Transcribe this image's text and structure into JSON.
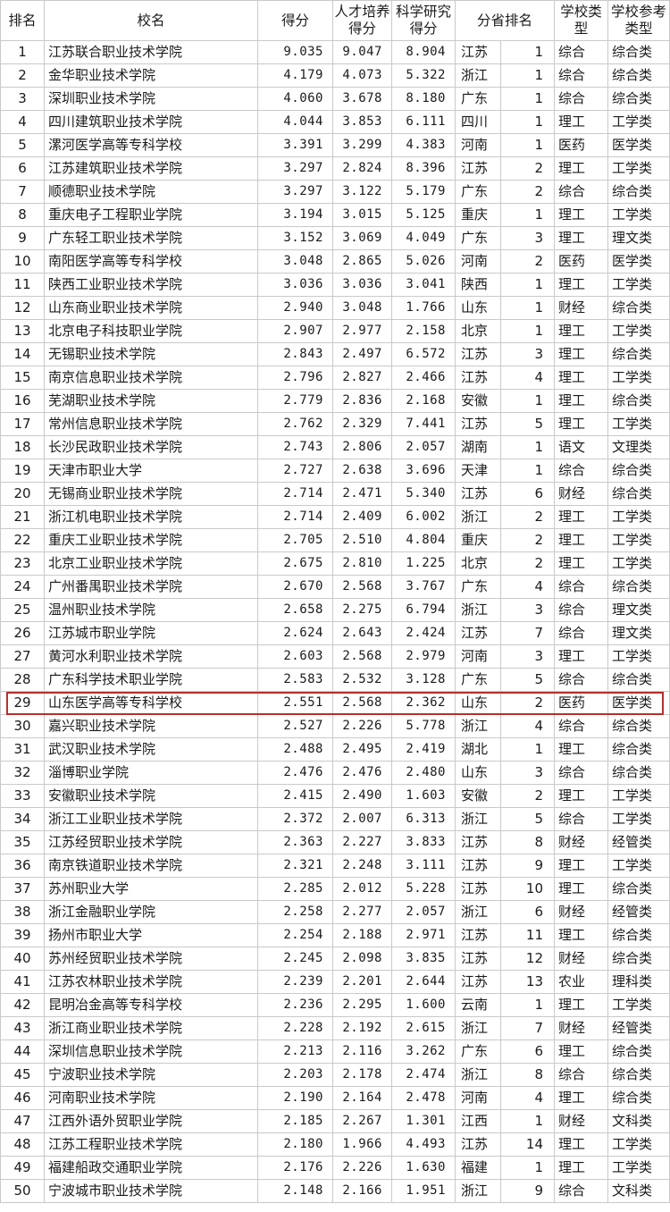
{
  "headers": {
    "rank": "排名",
    "name": "校名",
    "score": "得分",
    "talent": "人才培养得分",
    "research": "科学研究得分",
    "prov_rank": "分省排名",
    "school_type": "学校类型",
    "ref_type": "学校参考类型"
  },
  "highlight_rank": 29,
  "rows": [
    {
      "rank": "1",
      "name": "江苏联合职业技术学院",
      "score": "9.035",
      "talent": "9.047",
      "research": "8.904",
      "province": "江苏",
      "prov_rank": "1",
      "type": "综合",
      "ref": "综合类"
    },
    {
      "rank": "2",
      "name": "金华职业技术学院",
      "score": "4.179",
      "talent": "4.073",
      "research": "5.322",
      "province": "浙江",
      "prov_rank": "1",
      "type": "综合",
      "ref": "综合类"
    },
    {
      "rank": "3",
      "name": "深圳职业技术学院",
      "score": "4.060",
      "talent": "3.678",
      "research": "8.180",
      "province": "广东",
      "prov_rank": "1",
      "type": "综合",
      "ref": "综合类"
    },
    {
      "rank": "4",
      "name": "四川建筑职业技术学院",
      "score": "4.044",
      "talent": "3.853",
      "research": "6.111",
      "province": "四川",
      "prov_rank": "1",
      "type": "理工",
      "ref": "工学类"
    },
    {
      "rank": "5",
      "name": "漯河医学高等专科学校",
      "score": "3.391",
      "talent": "3.299",
      "research": "4.383",
      "province": "河南",
      "prov_rank": "1",
      "type": "医药",
      "ref": "医学类"
    },
    {
      "rank": "6",
      "name": "江苏建筑职业技术学院",
      "score": "3.297",
      "talent": "2.824",
      "research": "8.396",
      "province": "江苏",
      "prov_rank": "2",
      "type": "理工",
      "ref": "工学类"
    },
    {
      "rank": "7",
      "name": "顺德职业技术学院",
      "score": "3.297",
      "talent": "3.122",
      "research": "5.179",
      "province": "广东",
      "prov_rank": "2",
      "type": "综合",
      "ref": "综合类"
    },
    {
      "rank": "8",
      "name": "重庆电子工程职业学院",
      "score": "3.194",
      "talent": "3.015",
      "research": "5.125",
      "province": "重庆",
      "prov_rank": "1",
      "type": "理工",
      "ref": "工学类"
    },
    {
      "rank": "9",
      "name": "广东轻工职业技术学院",
      "score": "3.152",
      "talent": "3.069",
      "research": "4.049",
      "province": "广东",
      "prov_rank": "3",
      "type": "理工",
      "ref": "理文类"
    },
    {
      "rank": "10",
      "name": "南阳医学高等专科学校",
      "score": "3.048",
      "talent": "2.865",
      "research": "5.026",
      "province": "河南",
      "prov_rank": "2",
      "type": "医药",
      "ref": "医学类"
    },
    {
      "rank": "11",
      "name": "陕西工业职业技术学院",
      "score": "3.036",
      "talent": "3.036",
      "research": "3.041",
      "province": "陕西",
      "prov_rank": "1",
      "type": "理工",
      "ref": "工学类"
    },
    {
      "rank": "12",
      "name": "山东商业职业技术学院",
      "score": "2.940",
      "talent": "3.048",
      "research": "1.766",
      "province": "山东",
      "prov_rank": "1",
      "type": "财经",
      "ref": "综合类"
    },
    {
      "rank": "13",
      "name": "北京电子科技职业学院",
      "score": "2.907",
      "talent": "2.977",
      "research": "2.158",
      "province": "北京",
      "prov_rank": "1",
      "type": "理工",
      "ref": "工学类"
    },
    {
      "rank": "14",
      "name": "无锡职业技术学院",
      "score": "2.843",
      "talent": "2.497",
      "research": "6.572",
      "province": "江苏",
      "prov_rank": "3",
      "type": "理工",
      "ref": "综合类"
    },
    {
      "rank": "15",
      "name": "南京信息职业技术学院",
      "score": "2.796",
      "talent": "2.827",
      "research": "2.466",
      "province": "江苏",
      "prov_rank": "4",
      "type": "理工",
      "ref": "工学类"
    },
    {
      "rank": "16",
      "name": "芜湖职业技术学院",
      "score": "2.779",
      "talent": "2.836",
      "research": "2.168",
      "province": "安徽",
      "prov_rank": "1",
      "type": "理工",
      "ref": "综合类"
    },
    {
      "rank": "17",
      "name": "常州信息职业技术学院",
      "score": "2.762",
      "talent": "2.329",
      "research": "7.441",
      "province": "江苏",
      "prov_rank": "5",
      "type": "理工",
      "ref": "工学类"
    },
    {
      "rank": "18",
      "name": "长沙民政职业技术学院",
      "score": "2.743",
      "talent": "2.806",
      "research": "2.057",
      "province": "湖南",
      "prov_rank": "1",
      "type": "语文",
      "ref": "文理类"
    },
    {
      "rank": "19",
      "name": "天津市职业大学",
      "score": "2.727",
      "talent": "2.638",
      "research": "3.696",
      "province": "天津",
      "prov_rank": "1",
      "type": "综合",
      "ref": "综合类"
    },
    {
      "rank": "20",
      "name": "无锡商业职业技术学院",
      "score": "2.714",
      "talent": "2.471",
      "research": "5.340",
      "province": "江苏",
      "prov_rank": "6",
      "type": "财经",
      "ref": "综合类"
    },
    {
      "rank": "21",
      "name": "浙江机电职业技术学院",
      "score": "2.714",
      "talent": "2.409",
      "research": "6.002",
      "province": "浙江",
      "prov_rank": "2",
      "type": "理工",
      "ref": "工学类"
    },
    {
      "rank": "22",
      "name": "重庆工业职业技术学院",
      "score": "2.705",
      "talent": "2.510",
      "research": "4.804",
      "province": "重庆",
      "prov_rank": "2",
      "type": "理工",
      "ref": "工学类"
    },
    {
      "rank": "23",
      "name": "北京工业职业技术学院",
      "score": "2.675",
      "talent": "2.810",
      "research": "1.225",
      "province": "北京",
      "prov_rank": "2",
      "type": "理工",
      "ref": "工学类"
    },
    {
      "rank": "24",
      "name": "广州番禺职业技术学院",
      "score": "2.670",
      "talent": "2.568",
      "research": "3.767",
      "province": "广东",
      "prov_rank": "4",
      "type": "综合",
      "ref": "综合类"
    },
    {
      "rank": "25",
      "name": "温州职业技术学院",
      "score": "2.658",
      "talent": "2.275",
      "research": "6.794",
      "province": "浙江",
      "prov_rank": "3",
      "type": "综合",
      "ref": "理文类"
    },
    {
      "rank": "26",
      "name": "江苏城市职业学院",
      "score": "2.624",
      "talent": "2.643",
      "research": "2.424",
      "province": "江苏",
      "prov_rank": "7",
      "type": "综合",
      "ref": "理文类"
    },
    {
      "rank": "27",
      "name": "黄河水利职业技术学院",
      "score": "2.603",
      "talent": "2.568",
      "research": "2.979",
      "province": "河南",
      "prov_rank": "3",
      "type": "理工",
      "ref": "工学类"
    },
    {
      "rank": "28",
      "name": "广东科学技术职业学院",
      "score": "2.583",
      "talent": "2.532",
      "research": "3.128",
      "province": "广东",
      "prov_rank": "5",
      "type": "综合",
      "ref": "综合类"
    },
    {
      "rank": "29",
      "name": "山东医学高等专科学校",
      "score": "2.551",
      "talent": "2.568",
      "research": "2.362",
      "province": "山东",
      "prov_rank": "2",
      "type": "医药",
      "ref": "医学类"
    },
    {
      "rank": "30",
      "name": "嘉兴职业技术学院",
      "score": "2.527",
      "talent": "2.226",
      "research": "5.778",
      "province": "浙江",
      "prov_rank": "4",
      "type": "综合",
      "ref": "综合类"
    },
    {
      "rank": "31",
      "name": "武汉职业技术学院",
      "score": "2.488",
      "talent": "2.495",
      "research": "2.419",
      "province": "湖北",
      "prov_rank": "1",
      "type": "理工",
      "ref": "综合类"
    },
    {
      "rank": "32",
      "name": "淄博职业学院",
      "score": "2.476",
      "talent": "2.476",
      "research": "2.480",
      "province": "山东",
      "prov_rank": "3",
      "type": "综合",
      "ref": "综合类"
    },
    {
      "rank": "33",
      "name": "安徽职业技术学院",
      "score": "2.415",
      "talent": "2.490",
      "research": "1.603",
      "province": "安徽",
      "prov_rank": "2",
      "type": "理工",
      "ref": "工学类"
    },
    {
      "rank": "34",
      "name": "浙江工业职业技术学院",
      "score": "2.372",
      "talent": "2.007",
      "research": "6.313",
      "province": "浙江",
      "prov_rank": "5",
      "type": "综合",
      "ref": "工学类"
    },
    {
      "rank": "35",
      "name": "江苏经贸职业技术学院",
      "score": "2.363",
      "talent": "2.227",
      "research": "3.833",
      "province": "江苏",
      "prov_rank": "8",
      "type": "财经",
      "ref": "经管类"
    },
    {
      "rank": "36",
      "name": "南京铁道职业技术学院",
      "score": "2.321",
      "talent": "2.248",
      "research": "3.111",
      "province": "江苏",
      "prov_rank": "9",
      "type": "理工",
      "ref": "工学类"
    },
    {
      "rank": "37",
      "name": "苏州职业大学",
      "score": "2.285",
      "talent": "2.012",
      "research": "5.228",
      "province": "江苏",
      "prov_rank": "10",
      "type": "理工",
      "ref": "综合类"
    },
    {
      "rank": "38",
      "name": "浙江金融职业学院",
      "score": "2.258",
      "talent": "2.277",
      "research": "2.057",
      "province": "浙江",
      "prov_rank": "6",
      "type": "财经",
      "ref": "经管类"
    },
    {
      "rank": "39",
      "name": "扬州市职业大学",
      "score": "2.254",
      "talent": "2.188",
      "research": "2.971",
      "province": "江苏",
      "prov_rank": "11",
      "type": "理工",
      "ref": "综合类"
    },
    {
      "rank": "40",
      "name": "苏州经贸职业技术学院",
      "score": "2.245",
      "talent": "2.098",
      "research": "3.835",
      "province": "江苏",
      "prov_rank": "12",
      "type": "财经",
      "ref": "综合类"
    },
    {
      "rank": "41",
      "name": "江苏农林职业技术学院",
      "score": "2.239",
      "talent": "2.201",
      "research": "2.644",
      "province": "江苏",
      "prov_rank": "13",
      "type": "农业",
      "ref": "理科类"
    },
    {
      "rank": "42",
      "name": "昆明冶金高等专科学校",
      "score": "2.236",
      "talent": "2.295",
      "research": "1.600",
      "province": "云南",
      "prov_rank": "1",
      "type": "理工",
      "ref": "工学类"
    },
    {
      "rank": "43",
      "name": "浙江商业职业技术学院",
      "score": "2.228",
      "talent": "2.192",
      "research": "2.615",
      "province": "浙江",
      "prov_rank": "7",
      "type": "财经",
      "ref": "经管类"
    },
    {
      "rank": "44",
      "name": "深圳信息职业技术学院",
      "score": "2.213",
      "talent": "2.116",
      "research": "3.262",
      "province": "广东",
      "prov_rank": "6",
      "type": "理工",
      "ref": "综合类"
    },
    {
      "rank": "45",
      "name": "宁波职业技术学院",
      "score": "2.203",
      "talent": "2.178",
      "research": "2.474",
      "province": "浙江",
      "prov_rank": "8",
      "type": "综合",
      "ref": "综合类"
    },
    {
      "rank": "46",
      "name": "河南职业技术学院",
      "score": "2.190",
      "talent": "2.164",
      "research": "2.478",
      "province": "河南",
      "prov_rank": "4",
      "type": "理工",
      "ref": "综合类"
    },
    {
      "rank": "47",
      "name": "江西外语外贸职业学院",
      "score": "2.185",
      "talent": "2.267",
      "research": "1.301",
      "province": "江西",
      "prov_rank": "1",
      "type": "财经",
      "ref": "文科类"
    },
    {
      "rank": "48",
      "name": "江苏工程职业技术学院",
      "score": "2.180",
      "talent": "1.966",
      "research": "4.493",
      "province": "江苏",
      "prov_rank": "14",
      "type": "理工",
      "ref": "工学类"
    },
    {
      "rank": "49",
      "name": "福建船政交通职业学院",
      "score": "2.176",
      "talent": "2.226",
      "research": "1.630",
      "province": "福建",
      "prov_rank": "1",
      "type": "理工",
      "ref": "工学类"
    },
    {
      "rank": "50",
      "name": "宁波城市职业技术学院",
      "score": "2.148",
      "talent": "2.166",
      "research": "1.951",
      "province": "浙江",
      "prov_rank": "9",
      "type": "综合",
      "ref": "文科类"
    }
  ]
}
